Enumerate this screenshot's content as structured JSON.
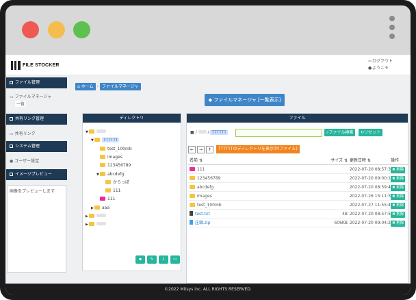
{
  "app": {
    "logo_text": "FILE STOCKER"
  },
  "user_menu": {
    "logout": "ログアウト",
    "welcome": "ようこそ"
  },
  "sidebar": {
    "sections": [
      {
        "title": "ファイル管理",
        "items": [
          "ファイルマネージャ",
          "一覧"
        ]
      },
      {
        "title": "共有リンク管理",
        "items": [
          "共有リンク"
        ]
      },
      {
        "title": "システム管理",
        "items": [
          "ユーザー設定"
        ]
      },
      {
        "title": "イメージプレビュー",
        "items": []
      }
    ],
    "preview_placeholder": "画像をプレビューします"
  },
  "breadcrumb": [
    "ホーム",
    "ファイルマネージャ"
  ],
  "page_title": "ファイルマネージャ [一覧表示]",
  "directory_panel": {
    "title": "ディレクトリ",
    "tree": [
      {
        "label": "",
        "depth": 0,
        "color": "yellow",
        "caret": "▼",
        "blurred": true
      },
      {
        "label": "TTTTTT",
        "depth": 1,
        "color": "yellow",
        "caret": "▼",
        "selected": true
      },
      {
        "label": "test_100mb",
        "depth": 2,
        "color": "yellow"
      },
      {
        "label": "images",
        "depth": 2,
        "color": "yellow"
      },
      {
        "label": "123456789",
        "depth": 2,
        "color": "yellow"
      },
      {
        "label": "abcdefg",
        "depth": 2,
        "color": "yellow",
        "caret": "▼"
      },
      {
        "label": "からっぽ",
        "depth": 3,
        "color": "yellow"
      },
      {
        "label": "111",
        "depth": 3,
        "color": "yellow"
      },
      {
        "label": "111",
        "depth": 2,
        "color": "pink"
      },
      {
        "label": "aaa",
        "depth": 1,
        "color": "yellow",
        "caret": "▶"
      },
      {
        "label": "",
        "depth": 0,
        "color": "yellow",
        "caret": "▶",
        "blurred": true
      },
      {
        "label": "",
        "depth": 0,
        "color": "yellow",
        "caret": "▶",
        "blurred": true
      }
    ]
  },
  "file_panel": {
    "title": "ファイル",
    "path_sep": "/",
    "current_dir": "TTTTTT",
    "search_placeholder": "",
    "search_button": "ファイル検索",
    "reset_button": "リセット",
    "show_dir_button": "TTTTTTのディレクトリを表示中(ファイル)",
    "columns": {
      "name": "名前 ⇅",
      "size": "サイズ ⇅",
      "date": "更新日時 ⇅",
      "op": "操作"
    },
    "rows": [
      {
        "name": "111",
        "type": "folder-pink",
        "size": "",
        "date": "2022-07-20 08:57:32",
        "op": "削除"
      },
      {
        "name": "123456789",
        "type": "folder",
        "size": "",
        "date": "2022-07-20 09:00:19",
        "op": "削除"
      },
      {
        "name": "abcdefg",
        "type": "folder",
        "size": "",
        "date": "2022-07-20 08:59:43",
        "op": "削除"
      },
      {
        "name": "images",
        "type": "folder",
        "size": "",
        "date": "2022-07-26 15:11:33",
        "op": "削除"
      },
      {
        "name": "test_100mb",
        "type": "folder",
        "size": "",
        "date": "2022-07-27 11:55:41",
        "op": "削除"
      },
      {
        "name": "test.txt",
        "type": "file",
        "size": "4B",
        "date": "2022-07-20 08:57:54",
        "op": "削除"
      },
      {
        "name": "圧縮.zip",
        "type": "zip",
        "size": "606KB",
        "date": "2022-07-20 09:04:27",
        "op": "削除"
      }
    ]
  },
  "footer": {
    "copyright": "©2022 Mitsys inc. ALL RIGHTS RESERVED."
  }
}
